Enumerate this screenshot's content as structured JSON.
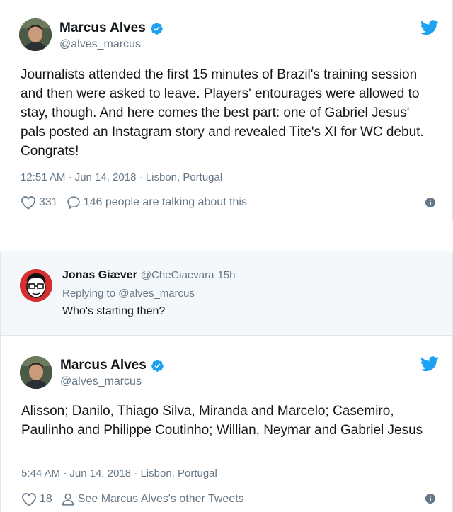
{
  "tweet1": {
    "name": "Marcus Alves",
    "handle": "@alves_marcus",
    "text": "Journalists attended the first 15 minutes of Brazil's training session and then were asked to leave. Players' entourages were allowed to stay, though. And here comes the best part: one of Gabriel Jesus' pals posted an Instagram story and revealed Tite's XI for WC debut. Congrats!",
    "timestamp": "12:51 AM - Jun 14, 2018",
    "separator": "·",
    "location": "Lisbon, Portugal",
    "likes": "331",
    "talking": "146 people are talking about this"
  },
  "reply": {
    "name": "Jonas Giæver",
    "handle": "@CheGiaevara",
    "time": "15h",
    "replying_to": "Replying to @alves_marcus",
    "text": "Who's starting then?"
  },
  "tweet2": {
    "name": "Marcus Alves",
    "handle": "@alves_marcus",
    "text": "Alisson; Danilo, Thiago Silva, Miranda and Marcelo; Casemiro, Paulinho and Philippe Coutinho; Willian, Neymar and Gabriel Jesus",
    "timestamp": "5:44 AM - Jun 14, 2018",
    "separator": "·",
    "location": "Lisbon, Portugal",
    "likes": "18",
    "other_tweets": "See Marcus Alves's other Tweets"
  },
  "colors": {
    "twitter_blue": "#1da1f2",
    "text_primary": "#14171a",
    "text_secondary": "#657786",
    "reply_bg": "#f5f8fa"
  },
  "icons": [
    "avatar",
    "verified-badge-icon",
    "twitter-bird-icon",
    "heart-icon",
    "speech-bubble-icon",
    "person-icon",
    "info-icon"
  ]
}
